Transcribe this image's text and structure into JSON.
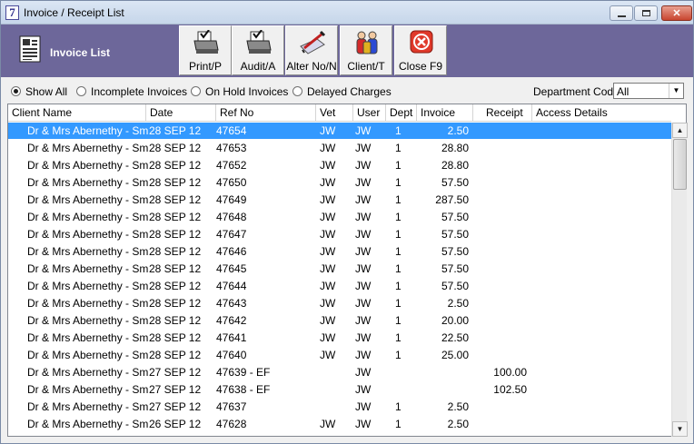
{
  "window": {
    "app_icon_glyph": "7",
    "title": "Invoice / Receipt List",
    "controls": [
      "minimize",
      "maximize",
      "close"
    ]
  },
  "header": {
    "title": "Invoice List",
    "icon": "document-list-icon",
    "background_color": "#6d679a"
  },
  "toolbar": {
    "buttons": [
      {
        "label": "Print/P",
        "icon": "printer-icon"
      },
      {
        "label": "Audit/A",
        "icon": "printer-audit-icon"
      },
      {
        "label": "Alter No/N",
        "icon": "pen-edit-icon"
      },
      {
        "label": "Client/T",
        "icon": "people-icon"
      },
      {
        "label": "Close F9",
        "icon": "close-icon"
      }
    ]
  },
  "filters": {
    "options": [
      {
        "label": "Show All",
        "selected": true
      },
      {
        "label": "Incomplete Invoices",
        "selected": false
      },
      {
        "label": "On Hold Invoices",
        "selected": false
      },
      {
        "label": "Delayed Charges",
        "selected": false
      }
    ],
    "department": {
      "label": "Department Code",
      "value": "All"
    }
  },
  "grid": {
    "columns": [
      "Client Name",
      "Date",
      "Ref No",
      "Vet",
      "User",
      "Dept",
      "Invoice",
      "Receipt",
      "Access Details"
    ],
    "selected_row": 0,
    "selection_color": "#3399ff",
    "rows": [
      {
        "client": "Dr & Mrs Abernethy - Smith",
        "date": "28 SEP 12",
        "ref": "47654",
        "vet": "JW",
        "user": "JW",
        "dept": "1",
        "invoice": "2.50",
        "receipt": ""
      },
      {
        "client": "Dr & Mrs Abernethy - Smith",
        "date": "28 SEP 12",
        "ref": "47653",
        "vet": "JW",
        "user": "JW",
        "dept": "1",
        "invoice": "28.80",
        "receipt": ""
      },
      {
        "client": "Dr & Mrs Abernethy - Smith",
        "date": "28 SEP 12",
        "ref": "47652",
        "vet": "JW",
        "user": "JW",
        "dept": "1",
        "invoice": "28.80",
        "receipt": ""
      },
      {
        "client": "Dr & Mrs Abernethy - Smith",
        "date": "28 SEP 12",
        "ref": "47650",
        "vet": "JW",
        "user": "JW",
        "dept": "1",
        "invoice": "57.50",
        "receipt": ""
      },
      {
        "client": "Dr & Mrs Abernethy - Smith",
        "date": "28 SEP 12",
        "ref": "47649",
        "vet": "JW",
        "user": "JW",
        "dept": "1",
        "invoice": "287.50",
        "receipt": ""
      },
      {
        "client": "Dr & Mrs Abernethy - Smith",
        "date": "28 SEP 12",
        "ref": "47648",
        "vet": "JW",
        "user": "JW",
        "dept": "1",
        "invoice": "57.50",
        "receipt": ""
      },
      {
        "client": "Dr & Mrs Abernethy - Smith",
        "date": "28 SEP 12",
        "ref": "47647",
        "vet": "JW",
        "user": "JW",
        "dept": "1",
        "invoice": "57.50",
        "receipt": ""
      },
      {
        "client": "Dr & Mrs Abernethy - Smith",
        "date": "28 SEP 12",
        "ref": "47646",
        "vet": "JW",
        "user": "JW",
        "dept": "1",
        "invoice": "57.50",
        "receipt": ""
      },
      {
        "client": "Dr & Mrs Abernethy - Smith",
        "date": "28 SEP 12",
        "ref": "47645",
        "vet": "JW",
        "user": "JW",
        "dept": "1",
        "invoice": "57.50",
        "receipt": ""
      },
      {
        "client": "Dr & Mrs Abernethy - Smith",
        "date": "28 SEP 12",
        "ref": "47644",
        "vet": "JW",
        "user": "JW",
        "dept": "1",
        "invoice": "57.50",
        "receipt": ""
      },
      {
        "client": "Dr & Mrs Abernethy - Smith",
        "date": "28 SEP 12",
        "ref": "47643",
        "vet": "JW",
        "user": "JW",
        "dept": "1",
        "invoice": "2.50",
        "receipt": ""
      },
      {
        "client": "Dr & Mrs Abernethy - Smith",
        "date": "28 SEP 12",
        "ref": "47642",
        "vet": "JW",
        "user": "JW",
        "dept": "1",
        "invoice": "20.00",
        "receipt": ""
      },
      {
        "client": "Dr & Mrs Abernethy - Smith",
        "date": "28 SEP 12",
        "ref": "47641",
        "vet": "JW",
        "user": "JW",
        "dept": "1",
        "invoice": "22.50",
        "receipt": ""
      },
      {
        "client": "Dr & Mrs Abernethy - Smith",
        "date": "28 SEP 12",
        "ref": "47640",
        "vet": "JW",
        "user": "JW",
        "dept": "1",
        "invoice": "25.00",
        "receipt": ""
      },
      {
        "client": "Dr & Mrs Abernethy - Smith",
        "date": "27 SEP 12",
        "ref": "47639 - EF",
        "vet": "",
        "user": "JW",
        "dept": "",
        "invoice": "",
        "receipt": "100.00"
      },
      {
        "client": "Dr & Mrs Abernethy - Smith",
        "date": "27 SEP 12",
        "ref": "47638 - EF",
        "vet": "",
        "user": "JW",
        "dept": "",
        "invoice": "",
        "receipt": "102.50"
      },
      {
        "client": "Dr & Mrs Abernethy - Smith",
        "date": "27 SEP 12",
        "ref": "47637",
        "vet": "",
        "user": "JW",
        "dept": "1",
        "invoice": "2.50",
        "receipt": ""
      },
      {
        "client": "Dr & Mrs Abernethy - Smith",
        "date": "26 SEP 12",
        "ref": "47628",
        "vet": "JW",
        "user": "JW",
        "dept": "1",
        "invoice": "2.50",
        "receipt": ""
      }
    ]
  }
}
